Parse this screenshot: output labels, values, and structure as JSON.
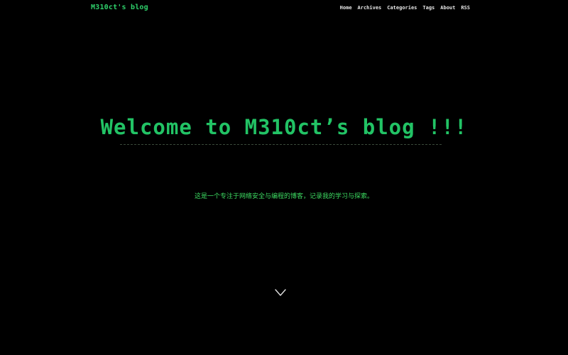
{
  "header": {
    "site_title": "M310ct's blog",
    "nav": [
      {
        "label": "Home"
      },
      {
        "label": "Archives"
      },
      {
        "label": "Categories"
      },
      {
        "label": "Tags"
      },
      {
        "label": "About"
      },
      {
        "label": "RSS"
      }
    ]
  },
  "hero": {
    "title": "Welcome to M310ct’s blog !!!",
    "subtitle": "这是一个专注于网络安全与编程的博客，记录我的学习与探索。",
    "scroll_icon": "chevron-down-icon"
  },
  "colors": {
    "background": "#000000",
    "accent": "#22c365",
    "nav_text": "#e6e6e6"
  }
}
